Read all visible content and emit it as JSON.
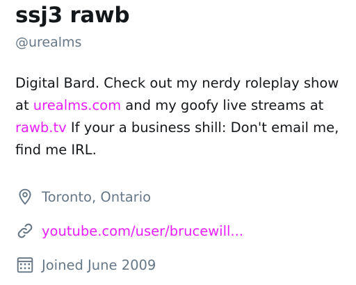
{
  "profile": {
    "name": "ssj3 rawb",
    "handle": "@urealms",
    "bio": {
      "part1": "Digital Bard. Check out my nerdy roleplay show at ",
      "link1": "urealms.com",
      "part2": " and my goofy live streams at ",
      "link2": "rawb.tv",
      "part3": " If your a business shill: Don't email me, find me IRL."
    },
    "location": "Toronto, Ontario",
    "url": "youtube.com/user/brucewill...",
    "joined": "Joined June 2009"
  },
  "colors": {
    "link": "#e81cff",
    "muted": "#657786",
    "text": "#14171a"
  },
  "icons": {
    "location": "location-pin-icon",
    "url": "link-icon",
    "joined": "calendar-icon"
  }
}
